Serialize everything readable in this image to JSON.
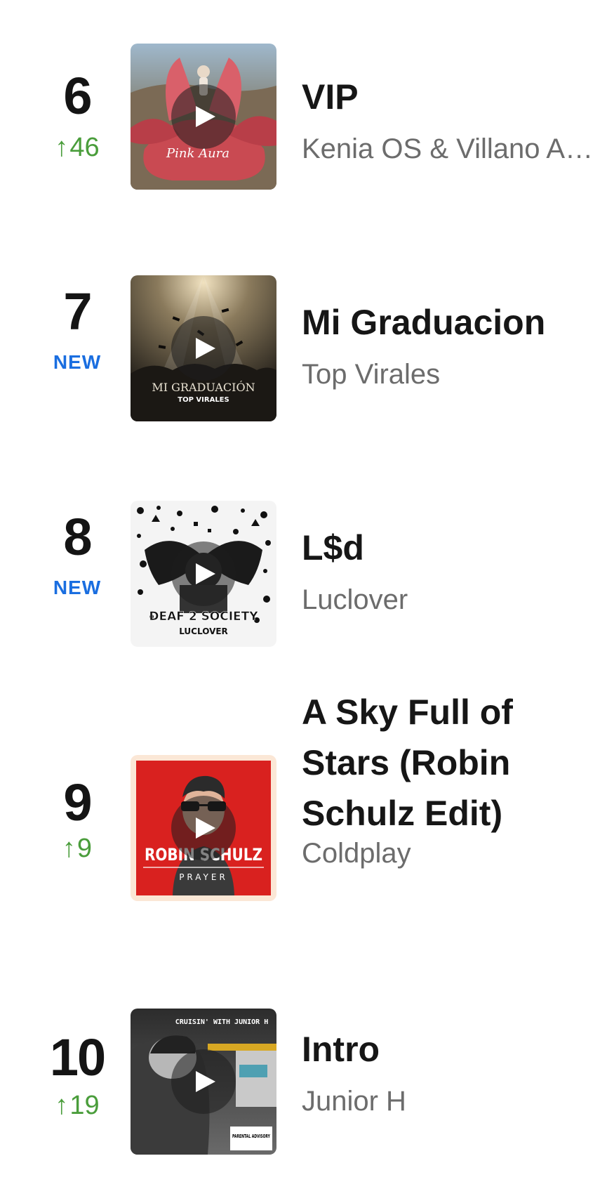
{
  "entries": [
    {
      "rank": "6",
      "change": {
        "type": "up",
        "arrow": "↑",
        "value": "46"
      },
      "title": "VIP",
      "artist": "Kenia OS & Villano Antillano",
      "artwork": {
        "icon": "album-art-pink-sculpture",
        "caption": "Pink Aura",
        "accent": "#c94a52"
      }
    },
    {
      "rank": "7",
      "change": {
        "type": "new",
        "label": "NEW"
      },
      "title": "Mi Graduacion",
      "artist": "Top Virales",
      "artwork": {
        "icon": "album-art-graduation",
        "caption_line1": "MI GRADUACIÓN",
        "caption_line2": "TOP VIRALES",
        "accent": "#2a2620"
      }
    },
    {
      "rank": "8",
      "change": {
        "type": "new",
        "label": "NEW"
      },
      "title": "L$d",
      "artist": "Luclover",
      "artwork": {
        "icon": "album-art-doodle",
        "caption_line1": "DEAF 2 SOCIETY",
        "caption_line2": "LUCLOVER",
        "accent": "#111111"
      }
    },
    {
      "rank": "9",
      "change": {
        "type": "up",
        "arrow": "↑",
        "value": "9"
      },
      "title": "A Sky Full of Stars (Robin Schulz Edit)",
      "artist": "Coldplay",
      "artwork": {
        "icon": "album-art-robin-schulz",
        "caption_line1": "ROBIN SCHULZ",
        "caption_line2": "PRAYER",
        "accent": "#d9211f"
      }
    },
    {
      "rank": "10",
      "change": {
        "type": "up",
        "arrow": "↑",
        "value": "19"
      },
      "title": "Intro",
      "artist": "Junior H",
      "artwork": {
        "icon": "album-art-car-interior",
        "caption_line1": "CRUISIN' WITH JUNIOR H",
        "caption_line2": "PARENTAL ADVISORY",
        "accent": "#3a3a3a"
      }
    }
  ],
  "icons": {
    "play": "play-icon"
  }
}
